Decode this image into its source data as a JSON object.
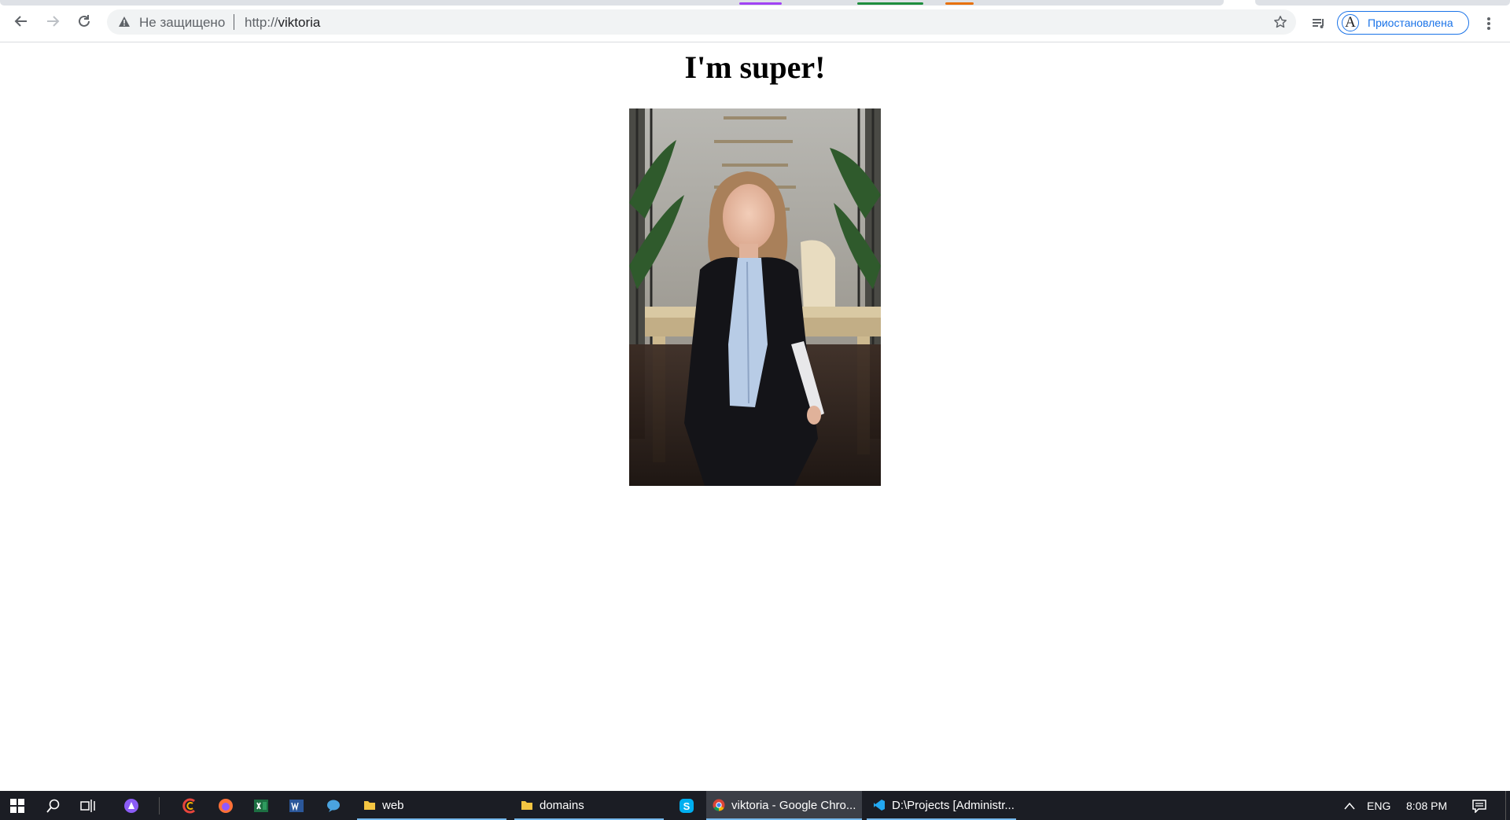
{
  "browser": {
    "security_label": "Не защищено",
    "url_scheme": "http://",
    "url_host": "viktoria",
    "profile_label": "Приостановлена",
    "profile_initial": "A",
    "tab_marks": [
      {
        "color": "#a142f4"
      },
      {
        "color": "#1e8e3e"
      },
      {
        "color": "#e8710a"
      }
    ]
  },
  "page": {
    "heading": "I'm super!"
  },
  "taskbar": {
    "windows": [
      {
        "label": "web",
        "icon": "folder-icon"
      },
      {
        "label": "domains",
        "icon": "folder-icon"
      },
      {
        "label": "viktoria - Google Chro...",
        "icon": "chrome-icon"
      },
      {
        "label": "D:\\Projects [Administr...",
        "icon": "vscode-icon"
      }
    ],
    "language": "ENG",
    "time": "8:08 PM"
  }
}
